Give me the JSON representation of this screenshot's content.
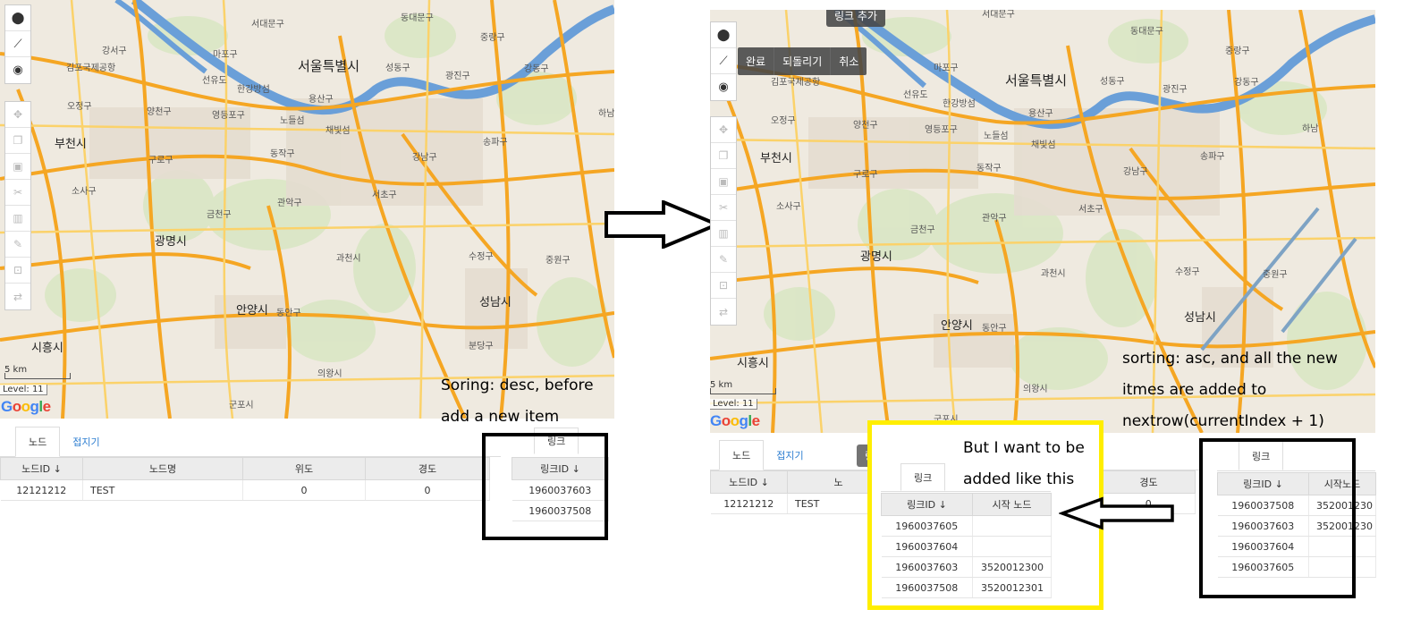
{
  "left_map": {
    "labels": {
      "seoul": "서울특별시",
      "gangseo": "강서구",
      "gimpo": "김포국제공항",
      "mapo": "마포구",
      "seodaemun": "서대문구",
      "dongdaemun": "동대문구",
      "jungnang": "중랑구",
      "seongdong": "성동구",
      "gwangjin": "광진구",
      "gangdong": "강동구",
      "seonyudo": "선유도",
      "hangang": "한강방섬",
      "yongsan": "용산구",
      "ojeong": "오정구",
      "yangcheon": "양천구",
      "yeongdeungpo": "영등포구",
      "nodeul": "노들섬",
      "chaebit": "채빛섬",
      "bucheon": "부천시",
      "guro": "구로구",
      "dongjak": "동작구",
      "gangnam": "강남구",
      "songpa": "송파구",
      "hanam": "하남",
      "sosa": "소사구",
      "geumcheon": "금천구",
      "gwanak": "관악구",
      "seocho": "서초구",
      "gwangmyeong": "광명시",
      "gwacheon": "과천시",
      "sujeong": "수정구",
      "jungwon": "중원구",
      "seongnam": "성남시",
      "anyang": "안양시",
      "dongan": "동안구",
      "bundang": "분당구",
      "siheung": "시흥시",
      "uiwang": "의왕시",
      "gunpo": "군포시"
    },
    "scale": "5 km",
    "level": "Level: 11",
    "toolbar": {
      "marker_icon": "pin-icon",
      "line_icon": "line-icon",
      "circle_icon": "circle-icon",
      "move_icon": "move-icon",
      "copy_icon": "copy-icon",
      "paste_icon": "paste-icon",
      "cut_icon": "scissors-icon",
      "delete_icon": "trash-icon",
      "edit_icon": "edit-icon",
      "select_icon": "select-area-icon",
      "swap_icon": "swap-icon"
    }
  },
  "left_panel": {
    "tabs": {
      "node": "노드",
      "fold": "접지기"
    },
    "node_table": {
      "headers": [
        "노드ID ↓",
        "노드명",
        "위도",
        "경도"
      ],
      "rows": [
        [
          "12121212",
          "TEST",
          "0",
          "0"
        ]
      ]
    },
    "link_tab": "링크",
    "link_table": {
      "header": "링크ID ↓",
      "rows": [
        "1960037603",
        "1960037508"
      ]
    },
    "note": [
      "Soring: desc, before",
      "add a new item"
    ]
  },
  "right_map": {
    "action_bar": [
      "완료",
      "되돌리기",
      "취소"
    ],
    "tooltip": "링크 추가",
    "scale": "5 km",
    "level": "Level: 11"
  },
  "right_panel": {
    "tabs": {
      "node": "노드",
      "fold": "접지기"
    },
    "node_table": {
      "headers": [
        "노드ID ↓",
        "노"
      ],
      "rows": [
        [
          "12121212",
          "TEST"
        ]
      ]
    },
    "ghost_tag": "링크 추가",
    "desired_tab": "링크",
    "desired_table": {
      "headers": [
        "링크ID ↓",
        "시작 노드"
      ],
      "rows": [
        [
          "1960037605",
          ""
        ],
        [
          "1960037604",
          ""
        ],
        [
          "1960037603",
          "3520012300"
        ],
        [
          "1960037508",
          "3520012301"
        ]
      ]
    },
    "bg_col": {
      "header": "경도",
      "cell": "0"
    },
    "actual_tab": "링크",
    "actual_table": {
      "headers": [
        "링크ID ↓",
        "시작노드"
      ],
      "rows": [
        [
          "1960037508",
          "352001230"
        ],
        [
          "1960037603",
          "352001230"
        ],
        [
          "1960037604",
          ""
        ],
        [
          "1960037605",
          ""
        ]
      ]
    },
    "note_top": [
      "sorting: asc, and all the new",
      "itmes are added to",
      "nextrow(currentIndex + 1)"
    ],
    "note_want": [
      "But I want to be",
      "added like this"
    ]
  },
  "colors": {
    "road_major": "#f5a623",
    "river": "#6a9fd8",
    "highlight_box": "#ffee00",
    "black_box": "#000000",
    "new_link": "#7ea3c4"
  }
}
